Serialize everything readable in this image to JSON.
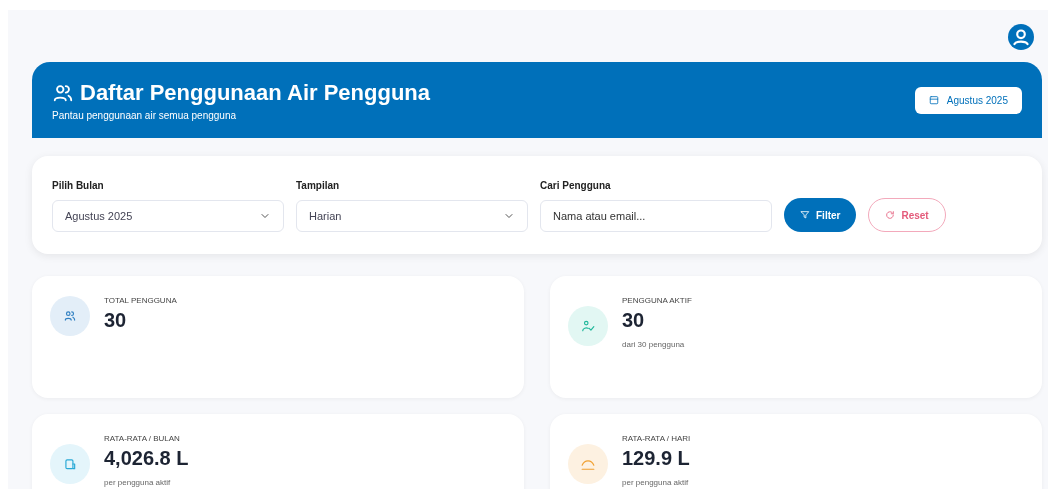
{
  "header": {
    "title": "Daftar Penggunaan Air Pengguna",
    "subtitle": "Pantau penggunaan air semua pengguna",
    "period_badge": "Agustus 2025"
  },
  "filters": {
    "month": {
      "label": "Pilih Bulan",
      "value": "Agustus 2025"
    },
    "view": {
      "label": "Tampilan",
      "value": "Harian"
    },
    "search": {
      "label": "Cari Pengguna",
      "placeholder": "Nama atau email..."
    },
    "buttons": [
      {
        "kind": "filter",
        "label": "Filter"
      },
      {
        "kind": "reset",
        "label": "Reset"
      }
    ]
  },
  "stats": [
    {
      "kind": "users",
      "label": "TOTAL PENGGUNA",
      "value": "30",
      "color": "#e3eef8"
    },
    {
      "kind": "active",
      "label": "PENGGUNA AKTIF",
      "value": "30",
      "note": "dari 30 pengguna",
      "color": "#e2f7f3"
    },
    {
      "kind": "month",
      "label": "RATA-RATA / BULAN",
      "value": "4,026.8 L",
      "note": "per pengguna aktif",
      "color": "#e4f5fb"
    },
    {
      "kind": "day",
      "label": "RATA-RATA / HARI",
      "value": "129.9 L",
      "note": "per pengguna aktif",
      "color": "#fdf1e1"
    }
  ]
}
